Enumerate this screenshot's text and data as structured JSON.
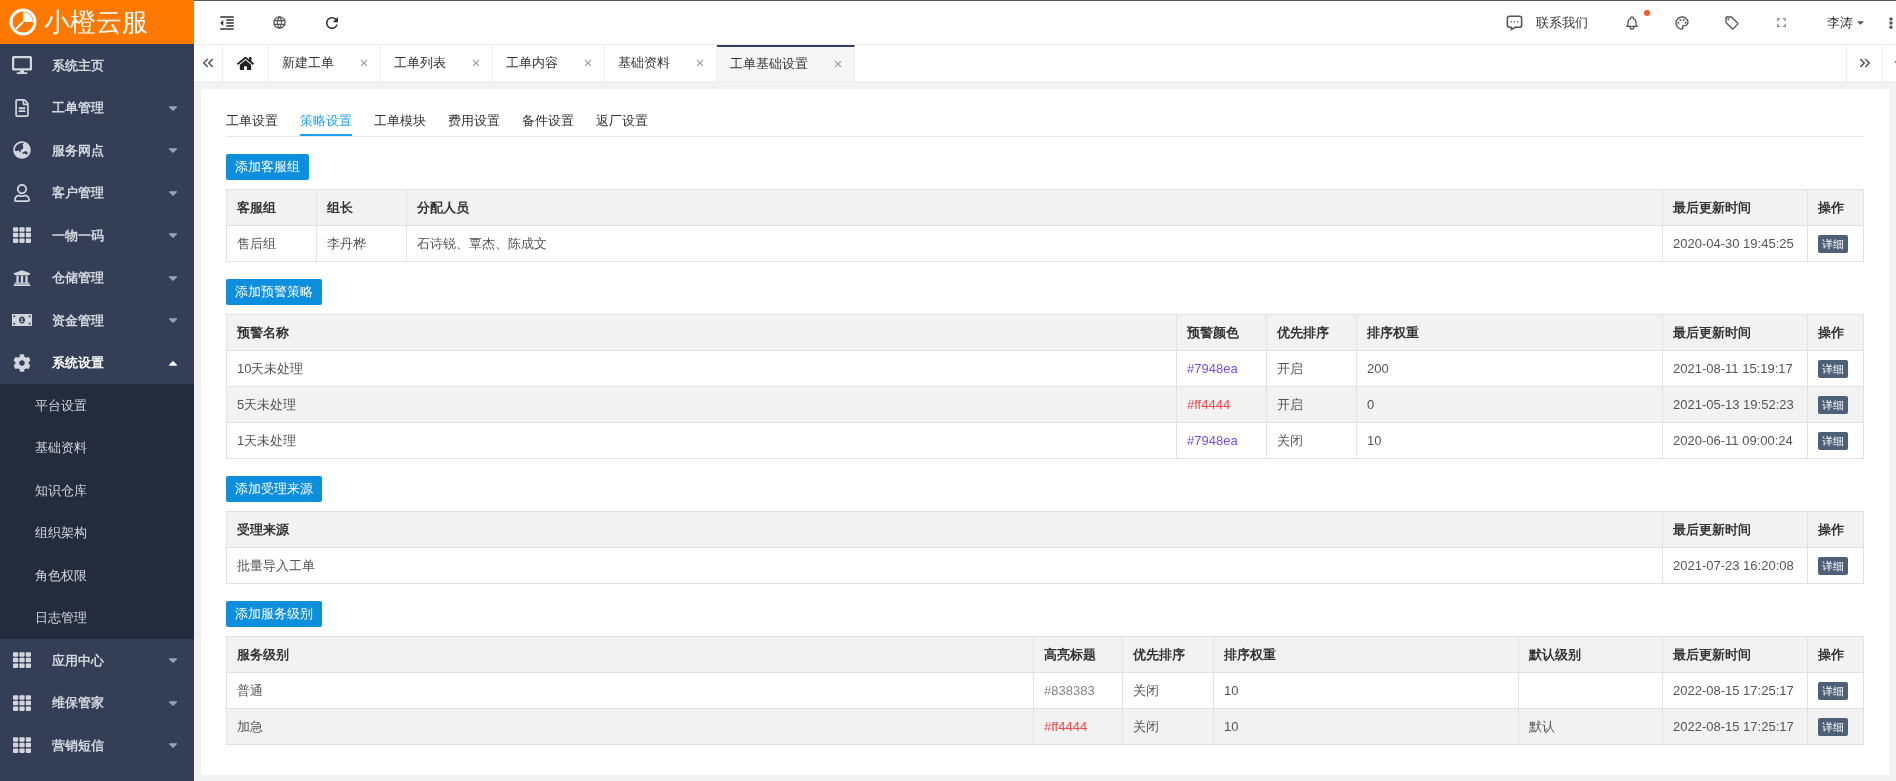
{
  "logo": {
    "text": "小橙云服"
  },
  "header": {
    "contact": "联系我们",
    "bell_alert": true,
    "user": "李涛"
  },
  "sidebar": {
    "items": [
      {
        "label": "系统主页",
        "has_children": false,
        "expanded": false
      },
      {
        "label": "工单管理",
        "has_children": true,
        "expanded": false
      },
      {
        "label": "服务网点",
        "has_children": true,
        "expanded": false
      },
      {
        "label": "客户管理",
        "has_children": true,
        "expanded": false
      },
      {
        "label": "一物一码",
        "has_children": true,
        "expanded": false
      },
      {
        "label": "仓储管理",
        "has_children": true,
        "expanded": false
      },
      {
        "label": "资金管理",
        "has_children": true,
        "expanded": false
      },
      {
        "label": "系统设置",
        "has_children": true,
        "expanded": true,
        "children": [
          {
            "label": "平台设置"
          },
          {
            "label": "基础资料"
          },
          {
            "label": "知识仓库"
          },
          {
            "label": "组织架构"
          },
          {
            "label": "角色权限"
          },
          {
            "label": "日志管理"
          }
        ]
      },
      {
        "label": "应用中心",
        "has_children": true,
        "expanded": false
      },
      {
        "label": "维保管家",
        "has_children": true,
        "expanded": false
      },
      {
        "label": "营销短信",
        "has_children": true,
        "expanded": false
      }
    ]
  },
  "page_tabs": [
    {
      "label": "新建工单",
      "selected": false
    },
    {
      "label": "工单列表",
      "selected": false
    },
    {
      "label": "工单内容",
      "selected": false
    },
    {
      "label": "基础资料",
      "selected": false
    },
    {
      "label": "工单基础设置",
      "selected": true
    }
  ],
  "sub_tabs": [
    {
      "label": "工单设置",
      "selected": false
    },
    {
      "label": "策略设置",
      "selected": true
    },
    {
      "label": "工单模块",
      "selected": false
    },
    {
      "label": "费用设置",
      "selected": false
    },
    {
      "label": "备件设置",
      "selected": false
    },
    {
      "label": "返厂设置",
      "selected": false
    }
  ],
  "sections": [
    {
      "button": "添加客服组",
      "columns": [
        "客服组",
        "组长",
        "分配人员",
        "最后更新时间",
        "操作"
      ],
      "rows": [
        {
          "cells": [
            "售后组",
            "李丹桦",
            "石诗锐、覃杰、陈成文",
            "2020-04-30 19:45:25"
          ],
          "action": "详细"
        }
      ]
    },
    {
      "button": "添加预警策略",
      "columns": [
        "预警名称",
        "预警颜色",
        "优先排序",
        "排序权重",
        "最后更新时间",
        "操作"
      ],
      "rows": [
        {
          "cells": [
            "10天未处理",
            {
              "text": "#7948ea",
              "color": "#7948ea"
            },
            "开启",
            "200",
            "2021-08-11 15:19:17"
          ],
          "action": "详细"
        },
        {
          "cells": [
            "5天未处理",
            {
              "text": "#ff4444",
              "color": "#ff4444"
            },
            "开启",
            "0",
            "2021-05-13 19:52:23"
          ],
          "action": "详细"
        },
        {
          "cells": [
            "1天未处理",
            {
              "text": "#7948ea",
              "color": "#7948ea"
            },
            "关闭",
            "10",
            "2020-06-11 09:00:24"
          ],
          "action": "详细"
        }
      ]
    },
    {
      "button": "添加受理来源",
      "columns": [
        "受理来源",
        "最后更新时间",
        "操作"
      ],
      "rows": [
        {
          "cells": [
            "批量导入工单",
            "2021-07-23 16:20:08"
          ],
          "action": "详细"
        }
      ]
    },
    {
      "button": "添加服务级别",
      "columns": [
        "服务级别",
        "高亮标题",
        "优先排序",
        "排序权重",
        "默认级别",
        "最后更新时间",
        "操作"
      ],
      "rows": [
        {
          "cells": [
            "普通",
            {
              "text": "#838383",
              "color": "#838383"
            },
            "关闭",
            "10",
            null,
            "2022-08-15 17:25:17"
          ],
          "action": "详细"
        },
        {
          "cells": [
            "加急",
            {
              "text": "#ff4444",
              "color": "#ff4444"
            },
            "关闭",
            "10",
            "默认",
            "2022-08-15 17:25:17"
          ],
          "action": "详细"
        }
      ]
    }
  ]
}
